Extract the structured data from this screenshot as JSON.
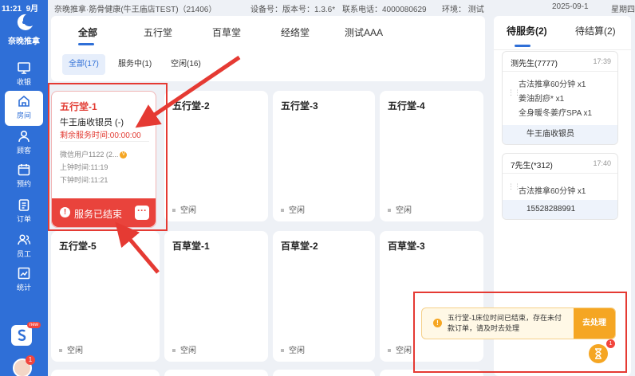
{
  "status_bar": {
    "time": "11:21",
    "date_short": "9月"
  },
  "brand": {
    "name": "奈晚推拿"
  },
  "sidebar": {
    "items": [
      {
        "label": "收银",
        "icon": "monitor-icon"
      },
      {
        "label": "房间",
        "icon": "house-icon",
        "active": true
      },
      {
        "label": "顾客",
        "icon": "user-icon"
      },
      {
        "label": "预约",
        "icon": "calendar-icon"
      },
      {
        "label": "订单",
        "icon": "clipboard-icon"
      },
      {
        "label": "员工",
        "icon": "team-icon"
      },
      {
        "label": "统计",
        "icon": "chart-icon"
      }
    ],
    "new_badge": "new",
    "avatar_badge": "1"
  },
  "topbar": {
    "store": "奈晚推拿·筋骨健康(牛王庙店TEST)（21406）",
    "device": "设备号：版本号：1.3.6*",
    "phone": "联系电话：4000080629",
    "env": "环境：  测试",
    "datetime": "2025-09-1",
    "weekday": "星期四"
  },
  "main": {
    "tabs": [
      "全部",
      "五行堂",
      "百草堂",
      "经络堂",
      "测试AAA"
    ],
    "subtabs": [
      "全部(17)",
      "服务中(1)",
      "空闲(16)"
    ],
    "ended_card": {
      "title": "五行堂-1",
      "staff": "牛王庙收银员 (-)",
      "remain": "剩余服务时间:00:00:00",
      "customer": "微信用户1122 (2...",
      "coin": "V",
      "clock_in": "上钟时间:11:19",
      "clock_out": "下钟时间:11:21",
      "footer": "服务已结束",
      "more": "···"
    },
    "rooms": [
      {
        "title": "五行堂-2",
        "status": "空闲"
      },
      {
        "title": "五行堂-3",
        "status": "空闲"
      },
      {
        "title": "五行堂-4",
        "status": "空闲"
      },
      {
        "title": "五行堂-5",
        "status": "空闲"
      },
      {
        "title": "百草堂-1",
        "status": "空闲"
      },
      {
        "title": "百草堂-2",
        "status": "空闲"
      },
      {
        "title": "百草堂-3",
        "status": "空闲"
      }
    ]
  },
  "right": {
    "tabs": [
      "待服务(2)",
      "待结算(2)"
    ],
    "orders": [
      {
        "name": "测先生(7777)",
        "time": "17:39",
        "items": [
          "古法推拿60分钟 x1",
          "姜油刮痧* x1",
          "全身暖冬姜疗SPA x1"
        ],
        "footer": "牛王庙收银员"
      },
      {
        "name": "7先生(*312)",
        "time": "17:40",
        "items": [
          "古法推拿60分钟 x1"
        ],
        "footer": "15528288991"
      }
    ]
  },
  "toast": {
    "message": "五行堂-1床位时间已结束，存在未付款订单，请及时去处理",
    "action": "去处理",
    "badge": "1"
  },
  "colors": {
    "primary": "#2f6fd7",
    "danger": "#e9433c",
    "warning": "#f5a623",
    "annotation": "#e53a33"
  }
}
